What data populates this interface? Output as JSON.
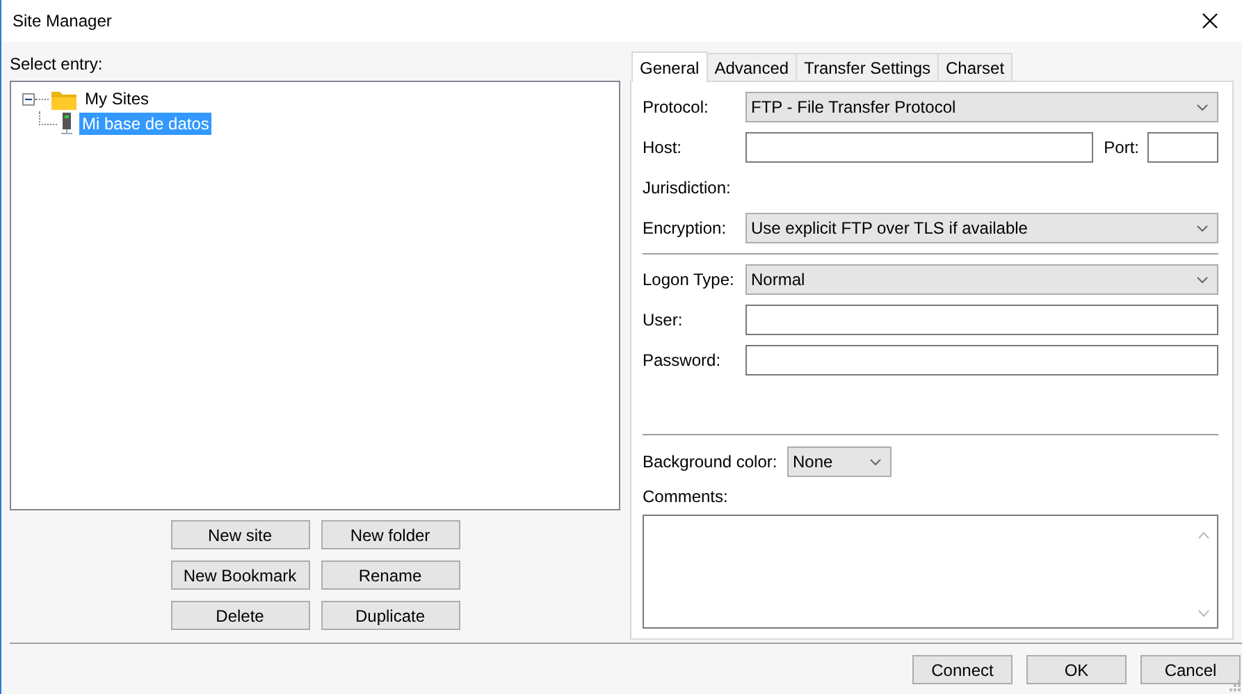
{
  "window": {
    "title": "Site Manager"
  },
  "entry_label": "Select entry:",
  "tree": [
    {
      "label": "My Sites",
      "kind": "folder",
      "expanded": true,
      "selected": false,
      "children": [
        {
          "label": "Mi base de datos",
          "kind": "site",
          "selected": true
        }
      ]
    }
  ],
  "tree_buttons": [
    [
      "New site",
      "New folder"
    ],
    [
      "New Bookmark",
      "Rename"
    ],
    [
      "Delete",
      "Duplicate"
    ]
  ],
  "tabs": [
    {
      "label": "General",
      "selected": true
    },
    {
      "label": "Advanced",
      "selected": false
    },
    {
      "label": "Transfer Settings",
      "selected": false
    },
    {
      "label": "Charset",
      "selected": false
    }
  ],
  "general": {
    "protocol": {
      "label": "Protocol:",
      "value": "FTP - File Transfer Protocol"
    },
    "host": {
      "label": "Host:"
    },
    "port": {
      "label": "Port:"
    },
    "jurisdiction": {
      "label": "Jurisdiction:"
    },
    "encryption": {
      "label": "Encryption:",
      "value": "Use explicit FTP over TLS if available"
    },
    "logon_type": {
      "label": "Logon Type:",
      "value": "Normal"
    },
    "user": {
      "label": "User:"
    },
    "password": {
      "label": "Password:"
    },
    "background_color": {
      "label": "Background color:",
      "value": "None"
    },
    "comments": {
      "label": "Comments:"
    }
  },
  "footer_buttons": [
    "Connect",
    "OK",
    "Cancel"
  ]
}
